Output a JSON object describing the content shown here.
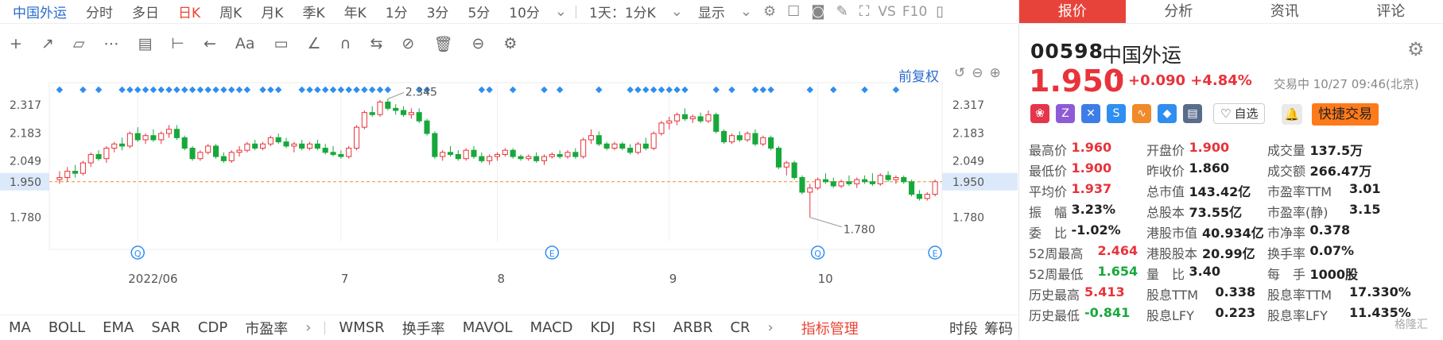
{
  "toolbar": {
    "stock_name": "中国外运",
    "periods": [
      "分时",
      "多日",
      "日K",
      "周K",
      "月K",
      "季K",
      "年K",
      "1分",
      "3分",
      "5分",
      "10分"
    ],
    "active_period": "日K",
    "interval_select": "1天：1分K",
    "display_label": "显示",
    "vs_label": "VS",
    "f10_label": "F10"
  },
  "drawing_tools": [
    "+",
    "↗",
    "▱",
    "⋯",
    "▤",
    "⊢",
    "←",
    "Aa",
    "▭",
    "∠",
    "∩",
    "⇆",
    "⊘",
    "🗑",
    "⊖",
    "⚙"
  ],
  "chart_controls": {
    "adjust_label": "前复权"
  },
  "chart_data": {
    "type": "candlestick",
    "y_ticks": [
      "2.317",
      "2.183",
      "2.049",
      "1.950",
      "1.780"
    ],
    "y_values": [
      2.317,
      2.183,
      2.049,
      1.95,
      1.78
    ],
    "ylim": [
      1.68,
      2.4
    ],
    "x_labels": [
      "2022/06",
      "7",
      "8",
      "9",
      "10"
    ],
    "current_price": "1.950",
    "high_annotation": "2.345",
    "low_annotation": "1.780",
    "event_markers": [
      "Q",
      "E",
      "Q",
      "E"
    ],
    "candles": [
      [
        1.96,
        2.0,
        1.94,
        1.97
      ],
      [
        1.97,
        2.02,
        1.95,
        2.0
      ],
      [
        2.0,
        2.03,
        1.97,
        1.99
      ],
      [
        1.99,
        2.05,
        1.98,
        2.04
      ],
      [
        2.04,
        2.09,
        2.02,
        2.08
      ],
      [
        2.08,
        2.1,
        2.05,
        2.06
      ],
      [
        2.06,
        2.12,
        2.04,
        2.11
      ],
      [
        2.11,
        2.14,
        2.09,
        2.13
      ],
      [
        2.13,
        2.16,
        2.1,
        2.12
      ],
      [
        2.12,
        2.19,
        2.11,
        2.18
      ],
      [
        2.18,
        2.21,
        2.14,
        2.15
      ],
      [
        2.15,
        2.18,
        2.13,
        2.17
      ],
      [
        2.17,
        2.2,
        2.14,
        2.15
      ],
      [
        2.15,
        2.19,
        2.13,
        2.18
      ],
      [
        2.18,
        2.22,
        2.16,
        2.2
      ],
      [
        2.2,
        2.22,
        2.15,
        2.16
      ],
      [
        2.16,
        2.17,
        2.1,
        2.11
      ],
      [
        2.11,
        2.12,
        2.05,
        2.06
      ],
      [
        2.06,
        2.1,
        2.05,
        2.09
      ],
      [
        2.09,
        2.13,
        2.08,
        2.12
      ],
      [
        2.12,
        2.13,
        2.06,
        2.07
      ],
      [
        2.07,
        2.09,
        2.04,
        2.05
      ],
      [
        2.05,
        2.1,
        2.04,
        2.09
      ],
      [
        2.09,
        2.12,
        2.07,
        2.1
      ],
      [
        2.1,
        2.14,
        2.09,
        2.13
      ],
      [
        2.13,
        2.15,
        2.1,
        2.11
      ],
      [
        2.11,
        2.14,
        2.1,
        2.13
      ],
      [
        2.13,
        2.17,
        2.12,
        2.16
      ],
      [
        2.16,
        2.18,
        2.13,
        2.14
      ],
      [
        2.14,
        2.16,
        2.11,
        2.12
      ],
      [
        2.12,
        2.14,
        2.09,
        2.13
      ],
      [
        2.13,
        2.15,
        2.1,
        2.11
      ],
      [
        2.11,
        2.14,
        2.1,
        2.13
      ],
      [
        2.13,
        2.15,
        2.1,
        2.11
      ],
      [
        2.11,
        2.13,
        2.08,
        2.09
      ],
      [
        2.09,
        2.12,
        2.07,
        2.08
      ],
      [
        2.08,
        2.1,
        2.06,
        2.07
      ],
      [
        2.07,
        2.12,
        2.06,
        2.11
      ],
      [
        2.11,
        2.22,
        2.1,
        2.21
      ],
      [
        2.21,
        2.29,
        2.2,
        2.28
      ],
      [
        2.28,
        2.31,
        2.26,
        2.27
      ],
      [
        2.27,
        2.34,
        2.26,
        2.33
      ],
      [
        2.33,
        2.345,
        2.29,
        2.3
      ],
      [
        2.3,
        2.32,
        2.27,
        2.29
      ],
      [
        2.29,
        2.31,
        2.26,
        2.27
      ],
      [
        2.27,
        2.3,
        2.25,
        2.28
      ],
      [
        2.28,
        2.3,
        2.23,
        2.24
      ],
      [
        2.24,
        2.25,
        2.17,
        2.18
      ],
      [
        2.18,
        2.19,
        2.06,
        2.07
      ],
      [
        2.07,
        2.1,
        2.05,
        2.09
      ],
      [
        2.09,
        2.12,
        2.07,
        2.08
      ],
      [
        2.08,
        2.1,
        2.05,
        2.06
      ],
      [
        2.06,
        2.11,
        2.05,
        2.1
      ],
      [
        2.1,
        2.12,
        2.06,
        2.07
      ],
      [
        2.07,
        2.09,
        2.04,
        2.05
      ],
      [
        2.05,
        2.08,
        2.03,
        2.07
      ],
      [
        2.07,
        2.09,
        2.05,
        2.08
      ],
      [
        2.08,
        2.11,
        2.07,
        2.1
      ],
      [
        2.1,
        2.11,
        2.06,
        2.07
      ],
      [
        2.07,
        2.08,
        2.05,
        2.06
      ],
      [
        2.06,
        2.08,
        2.05,
        2.07
      ],
      [
        2.07,
        2.09,
        2.04,
        2.05
      ],
      [
        2.05,
        2.08,
        2.03,
        2.07
      ],
      [
        2.07,
        2.09,
        2.06,
        2.08
      ],
      [
        2.08,
        2.1,
        2.06,
        2.07
      ],
      [
        2.07,
        2.1,
        2.06,
        2.09
      ],
      [
        2.09,
        2.11,
        2.06,
        2.07
      ],
      [
        2.07,
        2.16,
        2.06,
        2.15
      ],
      [
        2.15,
        2.2,
        2.13,
        2.17
      ],
      [
        2.17,
        2.19,
        2.12,
        2.13
      ],
      [
        2.13,
        2.14,
        2.1,
        2.11
      ],
      [
        2.11,
        2.14,
        2.1,
        2.13
      ],
      [
        2.13,
        2.14,
        2.1,
        2.11
      ],
      [
        2.11,
        2.13,
        2.08,
        2.09
      ],
      [
        2.09,
        2.14,
        2.08,
        2.13
      ],
      [
        2.13,
        2.16,
        2.1,
        2.11
      ],
      [
        2.11,
        2.19,
        2.1,
        2.18
      ],
      [
        2.18,
        2.24,
        2.17,
        2.23
      ],
      [
        2.23,
        2.26,
        2.2,
        2.24
      ],
      [
        2.24,
        2.28,
        2.22,
        2.27
      ],
      [
        2.27,
        2.3,
        2.24,
        2.25
      ],
      [
        2.25,
        2.27,
        2.23,
        2.26
      ],
      [
        2.26,
        2.28,
        2.23,
        2.24
      ],
      [
        2.24,
        2.29,
        2.23,
        2.27
      ],
      [
        2.27,
        2.28,
        2.18,
        2.19
      ],
      [
        2.19,
        2.2,
        2.13,
        2.14
      ],
      [
        2.14,
        2.18,
        2.13,
        2.17
      ],
      [
        2.17,
        2.19,
        2.14,
        2.15
      ],
      [
        2.15,
        2.19,
        2.14,
        2.18
      ],
      [
        2.18,
        2.2,
        2.12,
        2.13
      ],
      [
        2.13,
        2.17,
        2.12,
        2.16
      ],
      [
        2.16,
        2.17,
        2.1,
        2.11
      ],
      [
        2.11,
        2.12,
        2.01,
        2.02
      ],
      [
        2.02,
        2.05,
        1.98,
        2.04
      ],
      [
        2.04,
        2.05,
        1.96,
        1.97
      ],
      [
        1.97,
        1.98,
        1.89,
        1.9
      ],
      [
        1.9,
        1.94,
        1.78,
        1.92
      ],
      [
        1.92,
        1.97,
        1.91,
        1.96
      ],
      [
        1.96,
        1.99,
        1.94,
        1.95
      ],
      [
        1.95,
        1.97,
        1.92,
        1.93
      ],
      [
        1.93,
        1.96,
        1.92,
        1.95
      ],
      [
        1.95,
        1.98,
        1.93,
        1.94
      ],
      [
        1.94,
        1.97,
        1.92,
        1.96
      ],
      [
        1.96,
        1.98,
        1.94,
        1.95
      ],
      [
        1.95,
        1.99,
        1.93,
        1.94
      ],
      [
        1.94,
        1.99,
        1.93,
        1.98
      ],
      [
        1.98,
        2.0,
        1.95,
        1.96
      ],
      [
        1.96,
        1.98,
        1.94,
        1.97
      ],
      [
        1.97,
        1.98,
        1.94,
        1.95
      ],
      [
        1.95,
        1.96,
        1.88,
        1.89
      ],
      [
        1.89,
        1.91,
        1.86,
        1.87
      ],
      [
        1.87,
        1.9,
        1.86,
        1.89
      ],
      [
        1.89,
        1.96,
        1.88,
        1.95
      ]
    ],
    "dot_ranges": [
      [
        0,
        0
      ],
      [
        3,
        3
      ],
      [
        5,
        5
      ],
      [
        8,
        24
      ],
      [
        26,
        28
      ],
      [
        31,
        42
      ],
      [
        46,
        47
      ],
      [
        54,
        55
      ],
      [
        58,
        58
      ],
      [
        62,
        62
      ],
      [
        64,
        64
      ],
      [
        69,
        69
      ],
      [
        73,
        80
      ],
      [
        84,
        84
      ],
      [
        86,
        86
      ],
      [
        89,
        91
      ],
      [
        96,
        96
      ],
      [
        99,
        99
      ],
      [
        103,
        103
      ],
      [
        107,
        107
      ]
    ]
  },
  "indicators": {
    "items": [
      "MA",
      "BOLL",
      "EMA",
      "SAR",
      "CDP",
      "市盈率",
      "WMSR",
      "换手率",
      "MAVOL",
      "MACD",
      "KDJ",
      "RSI",
      "ARBR",
      "CR"
    ],
    "manage_label": "指标管理",
    "tail_labels": [
      "时段",
      "筹码"
    ]
  },
  "panel": {
    "tabs": [
      "报价",
      "分析",
      "资讯",
      "评论"
    ],
    "active_tab": "报价",
    "code": "00598",
    "name": "中国外运",
    "price": "1.950",
    "change": "+0.090",
    "change_pct": "+4.84%",
    "status": "交易中 10/27 09:46(北京)",
    "watch_label": "自选",
    "quick_trade_label": "快捷交易",
    "badges": [
      {
        "icon": "❀",
        "color": "#e6354a"
      },
      {
        "icon": "Z",
        "color": "#8e5bd6"
      },
      {
        "icon": "✕",
        "color": "#3d7de8"
      },
      {
        "icon": "S",
        "color": "#2f8ef0"
      },
      {
        "icon": "∿",
        "color": "#f08a2b"
      },
      {
        "icon": "◆",
        "color": "#2f8ef0"
      },
      {
        "icon": "▤",
        "color": "#5a6c8c"
      }
    ],
    "stats": [
      [
        {
          "label": "最高价",
          "value": "1.960",
          "color": "red"
        },
        {
          "label": "开盘价",
          "value": "1.900",
          "color": "red"
        },
        {
          "label": "成交量",
          "value": "137.5万",
          "color": "dark"
        }
      ],
      [
        {
          "label": "最低价",
          "value": "1.900",
          "color": "red"
        },
        {
          "label": "昨收价",
          "value": "1.860",
          "color": "dark"
        },
        {
          "label": "成交额",
          "value": "266.47万",
          "color": "dark"
        }
      ],
      [
        {
          "label": "平均价",
          "value": "1.937",
          "color": "red"
        },
        {
          "label": "总市值",
          "value": "143.42亿",
          "color": "dark"
        },
        {
          "label": "市盈率TTM",
          "value": "3.01",
          "color": "dark"
        }
      ],
      [
        {
          "label": "振　幅",
          "value": "3.23%",
          "color": "dark"
        },
        {
          "label": "总股本",
          "value": "73.55亿",
          "color": "dark"
        },
        {
          "label": "市盈率(静)",
          "value": "3.15",
          "color": "dark"
        }
      ],
      [
        {
          "label": "委　比",
          "value": "-1.02%",
          "color": "dark"
        },
        {
          "label": "港股市值",
          "value": "40.934亿",
          "color": "dark"
        },
        {
          "label": "市净率",
          "value": "0.378",
          "color": "dark"
        }
      ],
      [
        {
          "label": "52周最高",
          "value": "2.464",
          "color": "red"
        },
        {
          "label": "港股股本",
          "value": "20.99亿",
          "color": "dark"
        },
        {
          "label": "换手率",
          "value": "0.07%",
          "color": "dark"
        }
      ],
      [
        {
          "label": "52周最低",
          "value": "1.654",
          "color": "green"
        },
        {
          "label": "量　比",
          "value": "3.40",
          "color": "dark"
        },
        {
          "label": "每　手",
          "value": "1000股",
          "color": "dark"
        }
      ],
      [
        {
          "label": "历史最高",
          "value": "5.413",
          "color": "red"
        },
        {
          "label": "股息TTM",
          "value": "0.338",
          "color": "dark"
        },
        {
          "label": "股息率TTM",
          "value": "17.330%",
          "color": "dark"
        }
      ],
      [
        {
          "label": "历史最低",
          "value": "-0.841",
          "color": "green"
        },
        {
          "label": "股息LFY",
          "value": "0.223",
          "color": "dark"
        },
        {
          "label": "股息率LFY",
          "value": "11.435%",
          "color": "dark"
        }
      ]
    ],
    "watermark": "格隆汇"
  }
}
